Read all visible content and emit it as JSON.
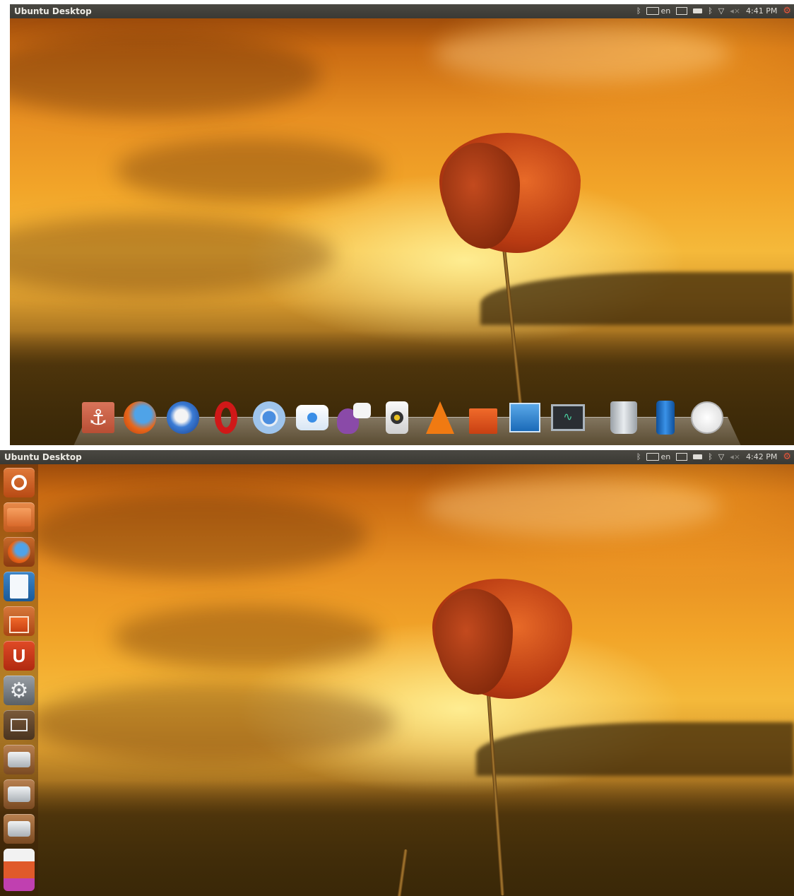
{
  "screens": [
    {
      "panel": {
        "title": "Ubuntu Desktop",
        "keyboard_layout": "en",
        "clock": "4:41 PM"
      },
      "dock": {
        "style": "bottom dock",
        "items": [
          {
            "name": "anchor-icon",
            "app": "Docky"
          },
          {
            "name": "firefox-icon",
            "app": "Firefox"
          },
          {
            "name": "thunderbird-icon",
            "app": "Thunderbird"
          },
          {
            "name": "opera-icon",
            "app": "Opera"
          },
          {
            "name": "chromium-icon",
            "app": "Chromium"
          },
          {
            "name": "chat-bubble-icon",
            "app": "Empathy"
          },
          {
            "name": "pidgin-icon",
            "app": "Pidgin"
          },
          {
            "name": "speaker-icon",
            "app": "Rhythmbox"
          },
          {
            "name": "vlc-icon",
            "app": "VLC"
          },
          {
            "name": "software-center-icon",
            "app": "Ubuntu Software Center"
          },
          {
            "name": "system-monitor-icon",
            "app": "System Monitor"
          },
          {
            "name": "terminal-monitor-icon",
            "app": "Terminal"
          },
          {
            "name": "trash-icon",
            "app": "Trash"
          },
          {
            "name": "battery-icon",
            "app": "Battery"
          },
          {
            "name": "clock-icon",
            "app": "Clock"
          }
        ]
      }
    },
    {
      "panel": {
        "title": "Ubuntu Desktop",
        "keyboard_layout": "en",
        "clock": "4:42 PM"
      },
      "launcher": {
        "items": [
          {
            "name": "dash-home-icon"
          },
          {
            "name": "files-folder-icon"
          },
          {
            "name": "firefox-icon"
          },
          {
            "name": "writer-document-icon"
          },
          {
            "name": "software-center-icon"
          },
          {
            "name": "ubuntu-one-icon",
            "text": "U"
          },
          {
            "name": "system-settings-icon"
          },
          {
            "name": "workspace-switcher-icon"
          },
          {
            "name": "drive-icon"
          },
          {
            "name": "drive-icon"
          },
          {
            "name": "drive-icon"
          },
          {
            "name": "usb-installer-icon"
          }
        ]
      }
    }
  ],
  "colors": {
    "panel": "#3c3b37",
    "panel_text": "#dfdbd2",
    "power_accent": "#e8553a",
    "sky": "#f2a529",
    "poppy": "#c8401a"
  }
}
